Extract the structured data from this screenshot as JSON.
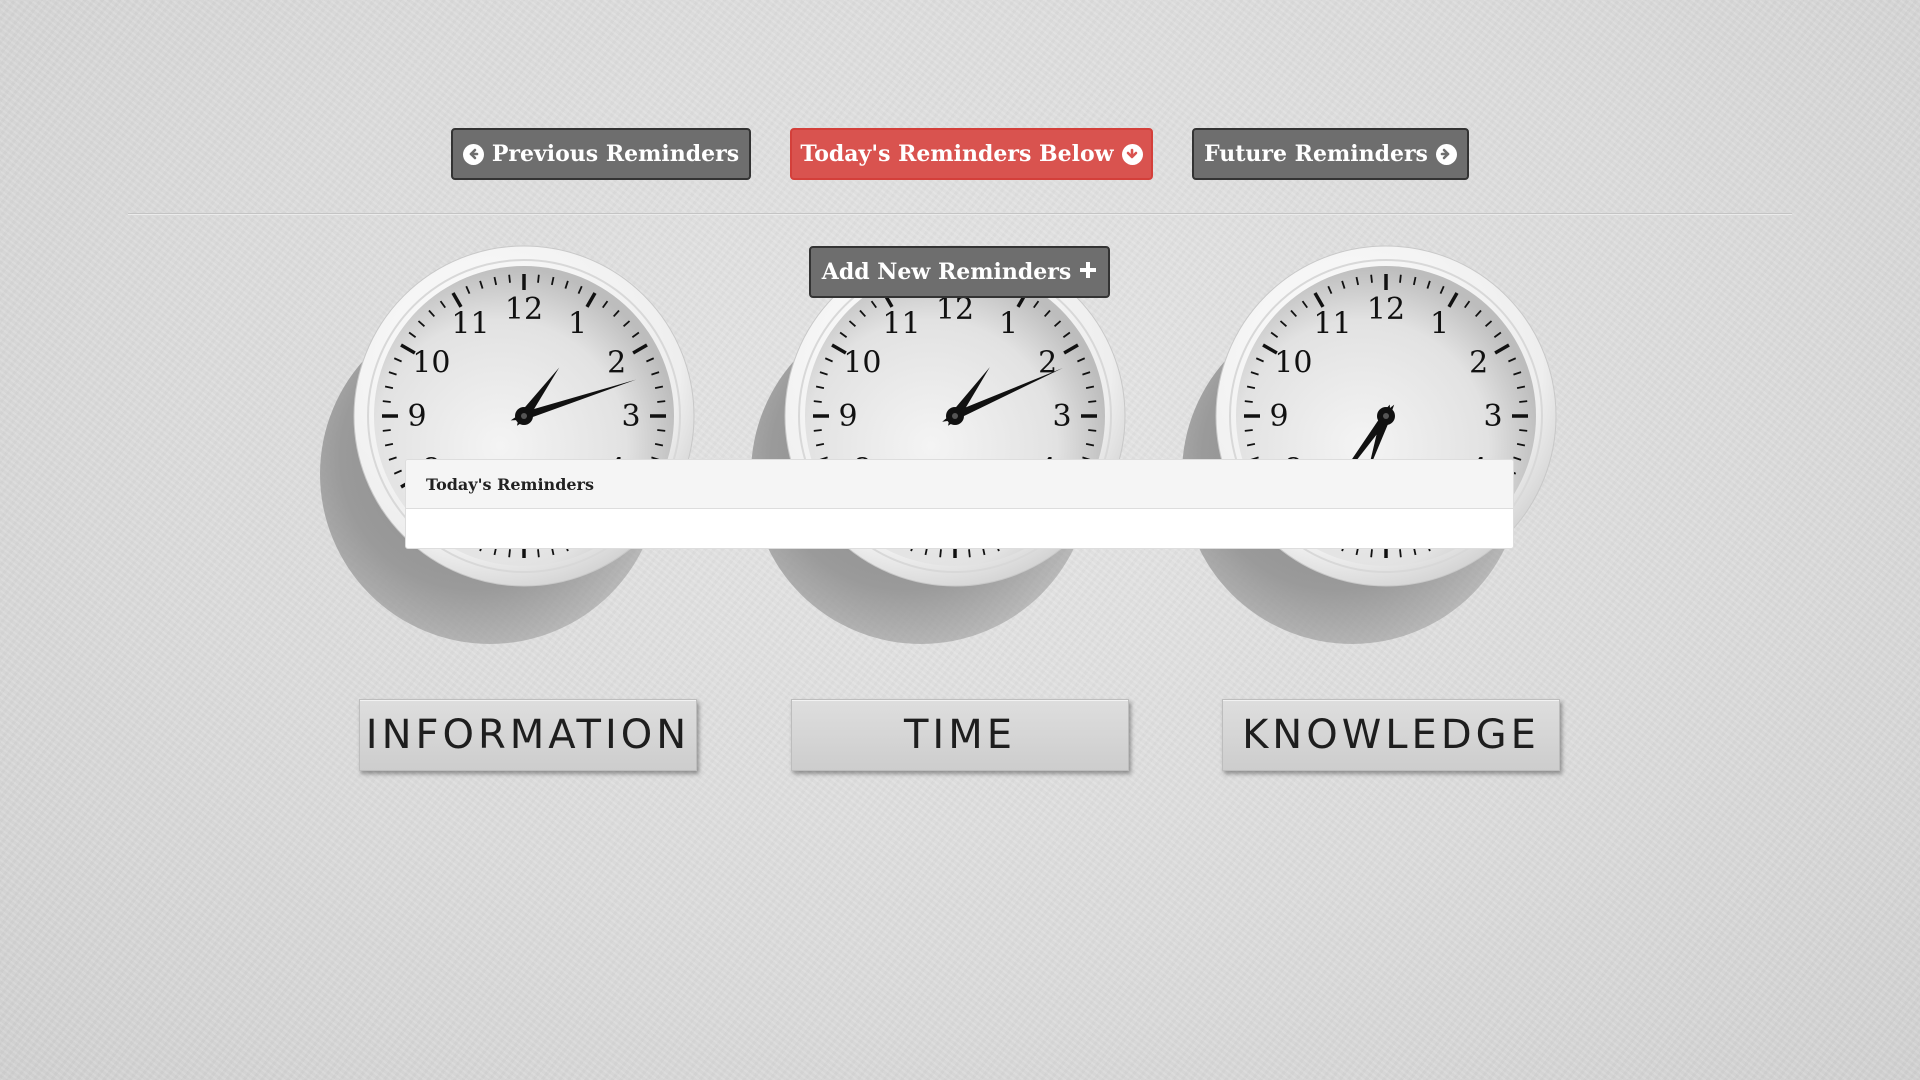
{
  "nav": {
    "previous_label": "Previous Reminders",
    "today_label": "Today's Reminders Below",
    "future_label": "Future Reminders",
    "today_color": "#d9534f",
    "button_color": "#6e6e6e"
  },
  "actions": {
    "add_label": "Add New Reminders"
  },
  "panel": {
    "heading": "Today's Reminders"
  },
  "clocks": [
    {
      "label": "INFORMATION",
      "hour": 1,
      "minute": 12
    },
    {
      "label": "TIME",
      "hour": 1,
      "minute": 11
    },
    {
      "label": "KNOWLEDGE",
      "hour": 6,
      "minute": 36
    }
  ]
}
